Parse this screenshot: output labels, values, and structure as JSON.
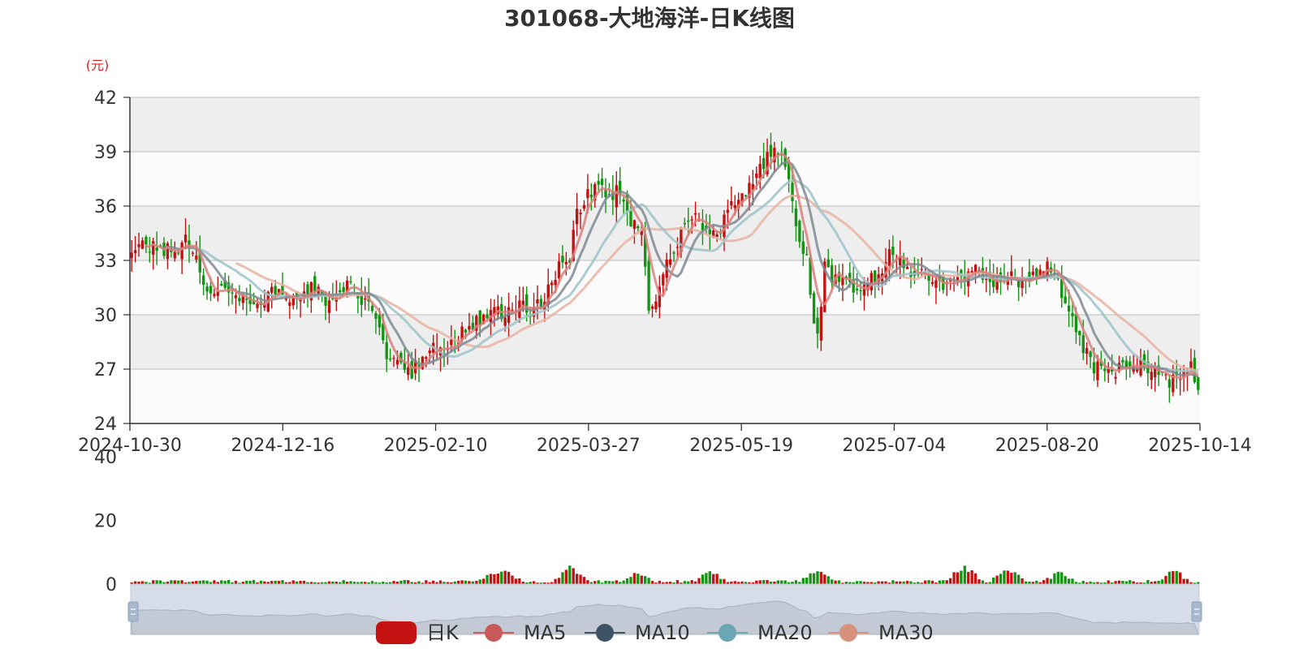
{
  "chart_data": {
    "type": "candlestick",
    "title": "301068-大地海洋-日K线图",
    "y_unit_label": "(元)",
    "price_axis": {
      "ylim": [
        24,
        42
      ],
      "ticks": [
        "24",
        "27",
        "30",
        "33",
        "36",
        "39",
        "42"
      ]
    },
    "volume_axis": {
      "ylim": [
        0,
        40
      ],
      "ticks": [
        "0",
        "20",
        "40"
      ]
    },
    "x_tick_labels": [
      "2024-10-30",
      "2024-12-16",
      "2025-02-10",
      "2025-03-27",
      "2025-05-19",
      "2025-07-04",
      "2025-08-20",
      "2025-10-14"
    ],
    "legend": [
      "日K",
      "MA5",
      "MA10",
      "MA20",
      "MA30"
    ],
    "colors": {
      "up": "#c41212",
      "down": "#139513",
      "ma5": "#d9817f",
      "ma10": "#7f8a93",
      "ma20": "#9fc3c9",
      "ma30": "#e8b3a5",
      "band": "#eeeeee",
      "grid": "#c8c8c8",
      "legend_k": "#c41212",
      "legend_ma5": "#c85a5a",
      "legend_ma10": "#3e5266",
      "legend_ma20": "#6aa6b3",
      "legend_ma30": "#d8917c"
    },
    "close_anchors": [
      [
        0,
        33.6
      ],
      [
        4,
        33.8
      ],
      [
        8,
        33.5
      ],
      [
        12,
        33.6
      ],
      [
        15,
        34.2
      ],
      [
        18,
        33.0
      ],
      [
        22,
        31.0
      ],
      [
        25,
        31.5
      ],
      [
        30,
        30.8
      ],
      [
        35,
        30.7
      ],
      [
        40,
        31.2
      ],
      [
        45,
        30.8
      ],
      [
        50,
        31.5
      ],
      [
        55,
        30.8
      ],
      [
        60,
        31.5
      ],
      [
        63,
        31.0
      ],
      [
        67,
        30.5
      ],
      [
        70,
        28.2
      ],
      [
        73,
        27.2
      ],
      [
        78,
        26.9
      ],
      [
        81,
        27.7
      ],
      [
        85,
        28.5
      ],
      [
        88,
        28.0
      ],
      [
        92,
        29.0
      ],
      [
        96,
        29.8
      ],
      [
        100,
        30.0
      ],
      [
        104,
        30.2
      ],
      [
        108,
        30.5
      ],
      [
        111,
        30.3
      ],
      [
        114,
        30.8
      ],
      [
        117,
        31.6
      ],
      [
        120,
        33.2
      ],
      [
        122,
        33.0
      ],
      [
        124,
        35.5
      ],
      [
        127,
        36.5
      ],
      [
        130,
        37.4
      ],
      [
        133,
        36.5
      ],
      [
        136,
        37.0
      ],
      [
        139,
        35.2
      ],
      [
        142,
        34.6
      ],
      [
        144,
        30.0
      ],
      [
        146,
        31.0
      ],
      [
        148,
        32.0
      ],
      [
        151,
        33.8
      ],
      [
        154,
        34.8
      ],
      [
        157,
        35.2
      ],
      [
        160,
        35.0
      ],
      [
        163,
        34.6
      ],
      [
        166,
        35.5
      ],
      [
        169,
        36.5
      ],
      [
        172,
        37.0
      ],
      [
        175,
        38.0
      ],
      [
        178,
        39.0
      ],
      [
        181,
        38.8
      ],
      [
        183,
        37.8
      ],
      [
        186,
        34.0
      ],
      [
        188,
        33.0
      ],
      [
        190,
        29.5
      ],
      [
        191,
        29.0
      ],
      [
        193,
        32.5
      ],
      [
        196,
        31.8
      ],
      [
        200,
        31.6
      ],
      [
        204,
        31.8
      ],
      [
        208,
        32.0
      ],
      [
        211,
        33.9
      ],
      [
        214,
        33.0
      ],
      [
        217,
        32.5
      ],
      [
        221,
        32.0
      ],
      [
        225,
        31.5
      ],
      [
        228,
        31.5
      ],
      [
        232,
        32.2
      ],
      [
        236,
        32.5
      ],
      [
        240,
        31.8
      ],
      [
        244,
        32.2
      ],
      [
        248,
        31.8
      ],
      [
        252,
        32.0
      ],
      [
        255,
        32.5
      ],
      [
        258,
        31.8
      ],
      [
        262,
        30.0
      ],
      [
        265,
        28.0
      ],
      [
        268,
        27.2
      ],
      [
        272,
        26.6
      ],
      [
        276,
        27.0
      ],
      [
        280,
        27.4
      ],
      [
        283,
        27.0
      ],
      [
        286,
        26.6
      ],
      [
        289,
        26.2
      ],
      [
        292,
        26.8
      ],
      [
        295,
        27.2
      ],
      [
        297,
        25.8
      ]
    ],
    "volume_bursts": [
      [
        100,
        2
      ],
      [
        104,
        3
      ],
      [
        122,
        5
      ],
      [
        141,
        3
      ],
      [
        161,
        3
      ],
      [
        191,
        4
      ],
      [
        232,
        6
      ],
      [
        244,
        5
      ],
      [
        258,
        3
      ],
      [
        290,
        4
      ]
    ]
  },
  "page": {
    "title": "301068-大地海洋-日K线图",
    "y_unit": "(元)"
  }
}
